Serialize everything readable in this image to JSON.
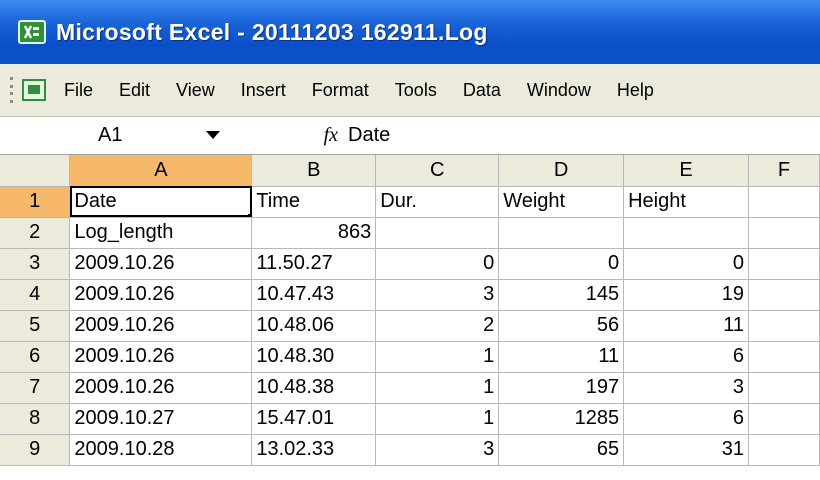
{
  "window": {
    "title": "Microsoft Excel - 20111203 162911.Log",
    "title_color": "#ffffff",
    "bar_color": "#0a4fc9"
  },
  "menu": [
    "File",
    "Edit",
    "View",
    "Insert",
    "Format",
    "Tools",
    "Data",
    "Window",
    "Help"
  ],
  "formula_bar": {
    "name_box": "A1",
    "fx_label": "fx",
    "content": "Date"
  },
  "columns": [
    "A",
    "B",
    "C",
    "D",
    "E",
    "F"
  ],
  "selected_column": "A",
  "active_cell": "A1",
  "rows": [
    {
      "n": "1",
      "cells": [
        "Date",
        "Time",
        "Dur.",
        "Weight",
        "Height",
        ""
      ]
    },
    {
      "n": "2",
      "cells": [
        "Log_length",
        "863",
        "",
        "",
        "",
        ""
      ]
    },
    {
      "n": "3",
      "cells": [
        "2009.10.26",
        "11.50.27",
        "0",
        "0",
        "0",
        ""
      ]
    },
    {
      "n": "4",
      "cells": [
        "2009.10.26",
        "10.47.43",
        "3",
        "145",
        "19",
        ""
      ]
    },
    {
      "n": "5",
      "cells": [
        "2009.10.26",
        "10.48.06",
        "2",
        "56",
        "11",
        ""
      ]
    },
    {
      "n": "6",
      "cells": [
        "2009.10.26",
        "10.48.30",
        "1",
        "11",
        "6",
        ""
      ]
    },
    {
      "n": "7",
      "cells": [
        "2009.10.26",
        "10.48.38",
        "1",
        "197",
        "3",
        ""
      ]
    },
    {
      "n": "8",
      "cells": [
        "2009.10.27",
        "15.47.01",
        "1",
        "1285",
        "6",
        ""
      ]
    },
    {
      "n": "9",
      "cells": [
        "2009.10.28",
        "13.02.33",
        "3",
        "65",
        "31",
        ""
      ]
    }
  ],
  "colors": {
    "selected_header": "#f6b86a",
    "chrome": "#eceada",
    "gridline": "#b8b8b8"
  }
}
